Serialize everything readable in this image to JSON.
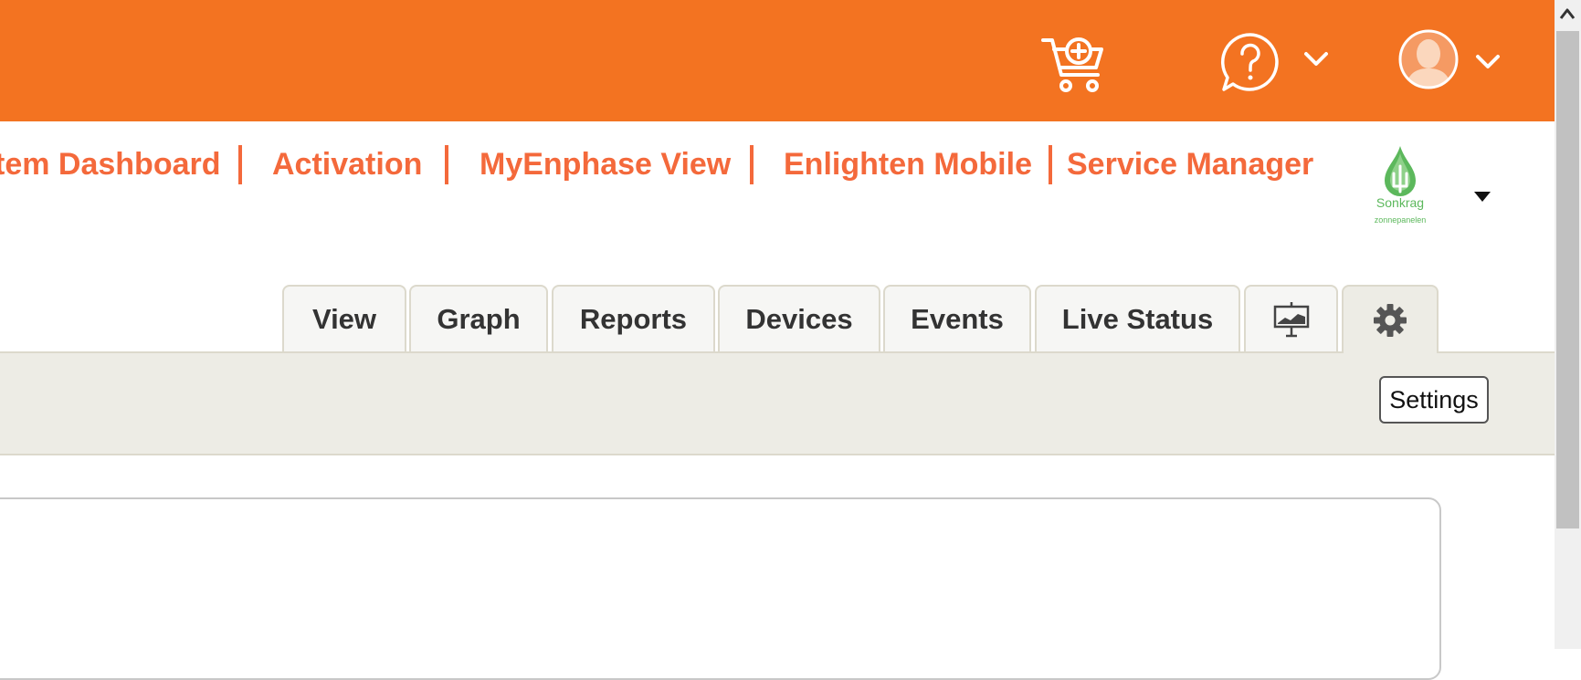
{
  "header": {
    "icons": {
      "cart": "cart-add-icon",
      "help": "help-icon",
      "help_dropdown": "chevron-down-icon",
      "user": "avatar-icon",
      "user_dropdown": "chevron-down-icon"
    },
    "colors": {
      "bar": "#f37321",
      "icon": "#ffffff"
    }
  },
  "nav": {
    "links": [
      {
        "label": "tem Dashboard"
      },
      {
        "label": "Activation"
      },
      {
        "label": "MyEnphase View"
      },
      {
        "label": "Enlighten Mobile"
      },
      {
        "label": "Service Manager"
      }
    ],
    "color": "#f4693b"
  },
  "account": {
    "logo_name": "Sonkrag",
    "logo_sub": "zonnepanelen",
    "logo_color": "#5cb85c"
  },
  "tabs": [
    {
      "label": "View"
    },
    {
      "label": "Graph"
    },
    {
      "label": "Reports"
    },
    {
      "label": "Devices"
    },
    {
      "label": "Events"
    },
    {
      "label": "Live Status"
    },
    {
      "icon": "presentation-board-icon"
    },
    {
      "icon": "gear-icon",
      "active": true
    }
  ],
  "tooltip": {
    "text": "Settings"
  }
}
